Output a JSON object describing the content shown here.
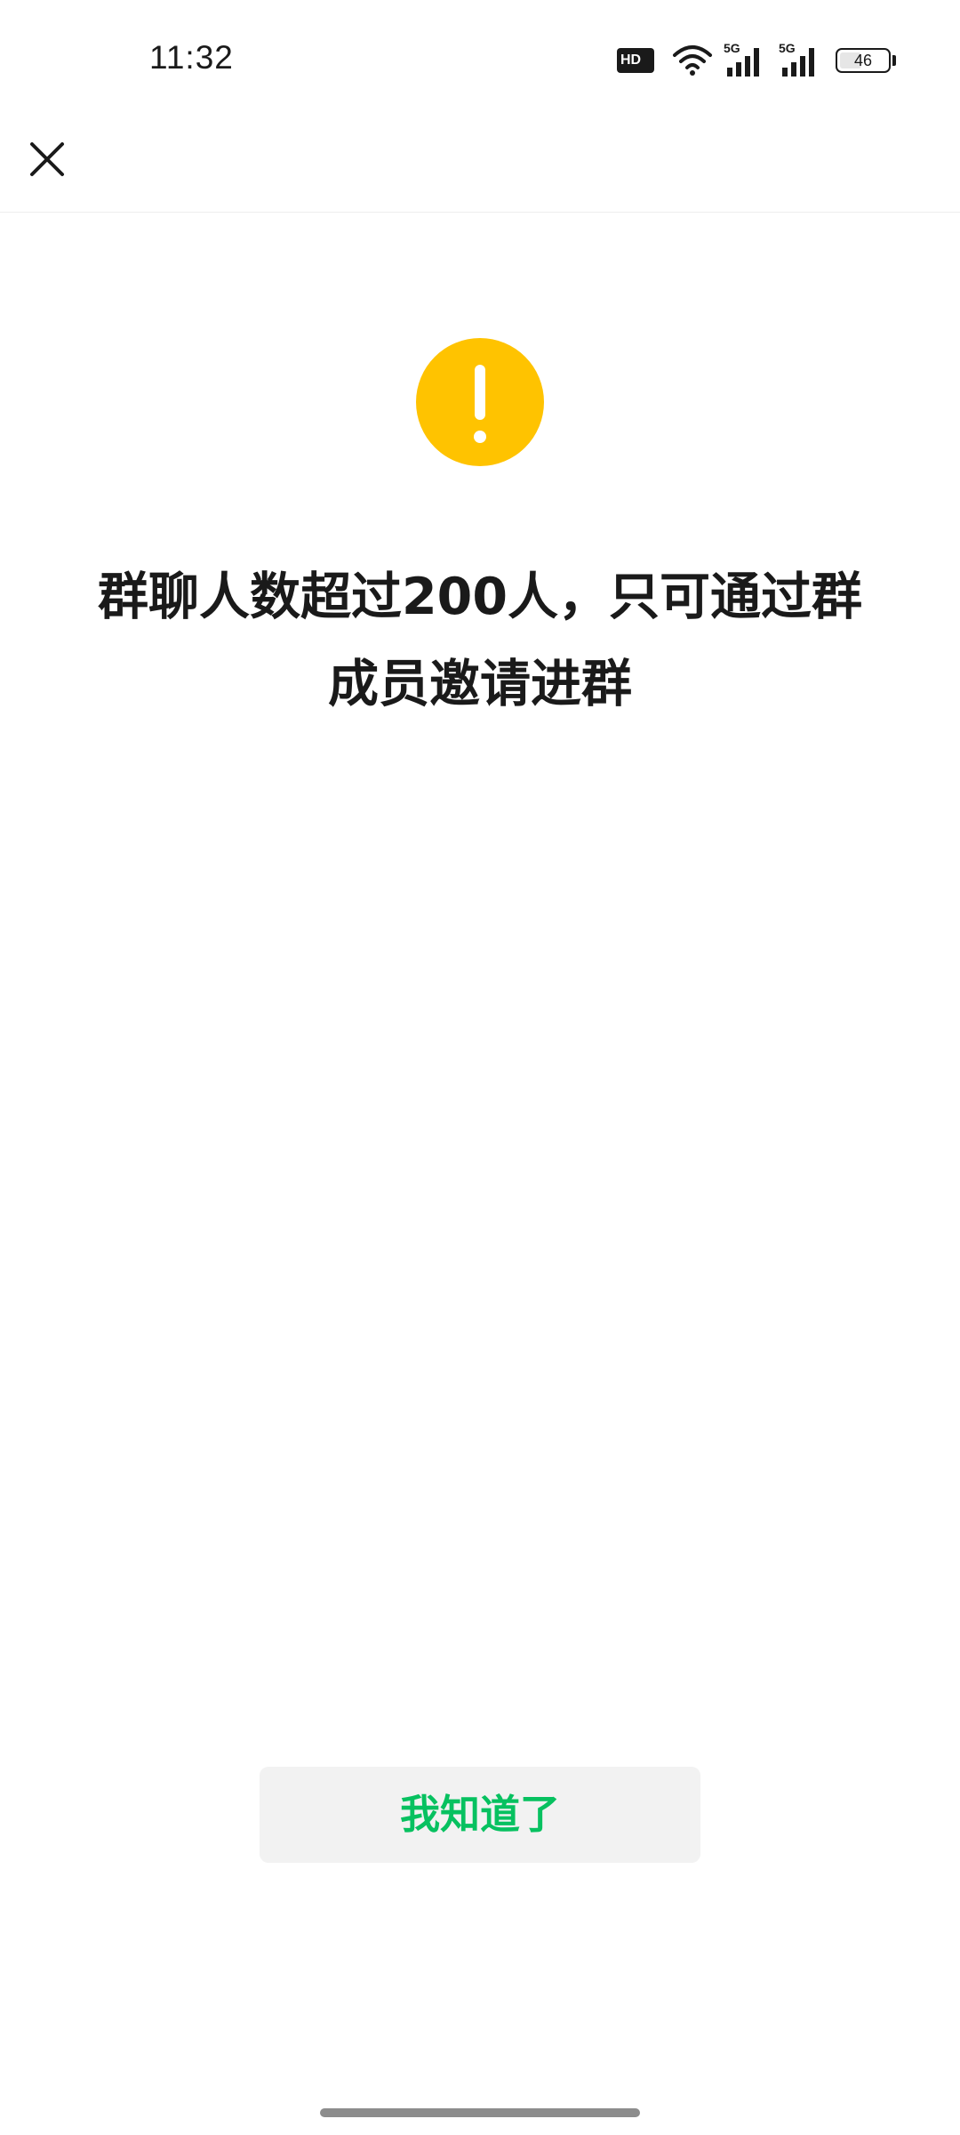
{
  "status_bar": {
    "time": "11:32",
    "hd_label": "HD",
    "network_label_1": "5G",
    "network_label_2": "5G",
    "battery_level": "46",
    "icons": [
      "hd-icon",
      "wifi-icon",
      "signal-icon",
      "signal-icon",
      "battery-icon"
    ]
  },
  "nav": {
    "close_icon": "close-icon"
  },
  "dialog": {
    "icon": "warning-icon",
    "icon_color": "#FFC300",
    "message": "群聊人数超过200人，只可通过群成员邀请进群",
    "confirm_label": "我知道了",
    "accent_color": "#07C160"
  }
}
